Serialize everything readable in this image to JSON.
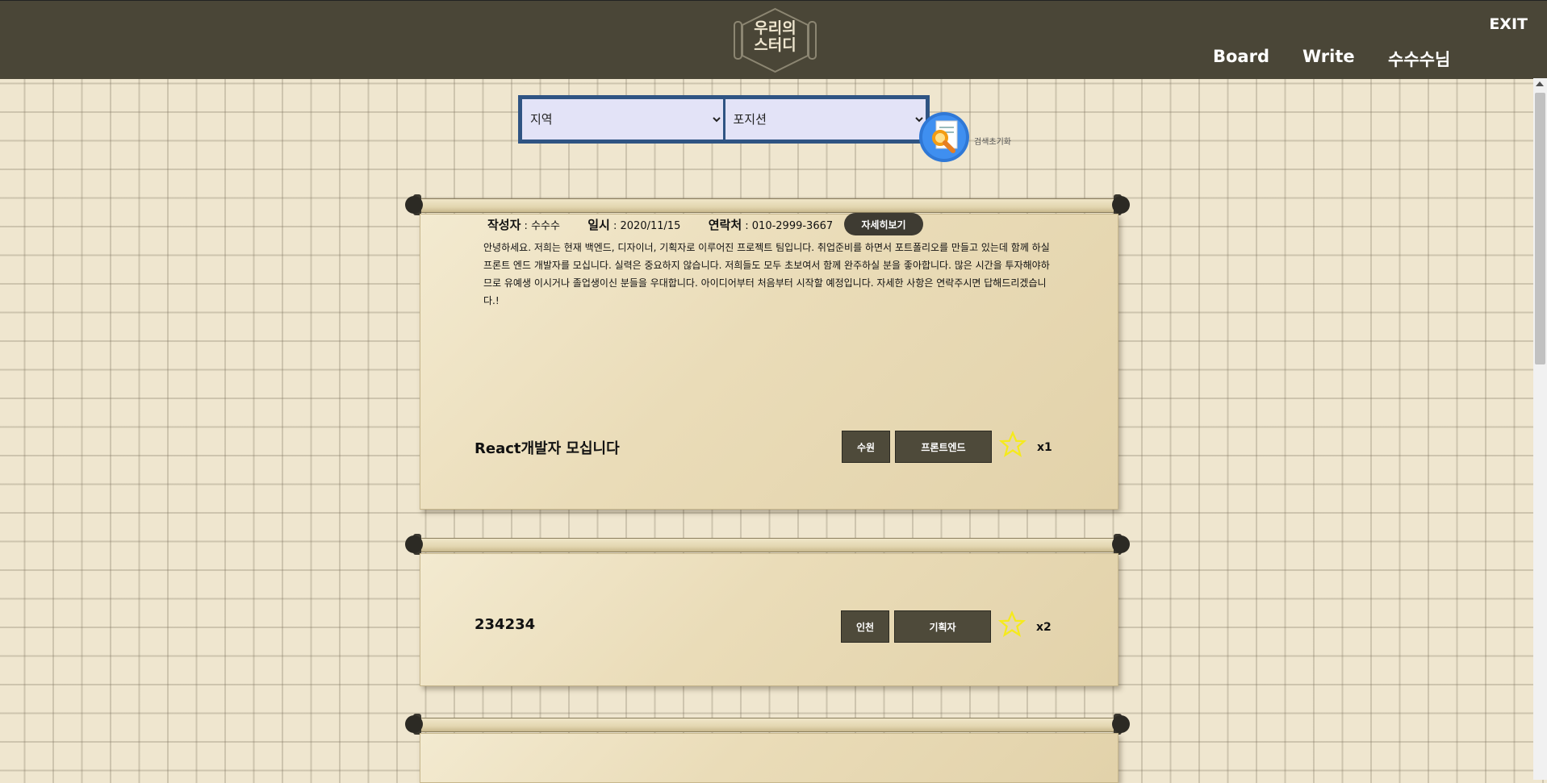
{
  "header": {
    "logo_text": "우리의\n스터디",
    "exit_label": "EXIT",
    "nav": {
      "board": "Board",
      "write": "Write",
      "user": "수수수님"
    }
  },
  "search": {
    "region_selected": "지역",
    "position_selected": "포지션",
    "reset_label": "검색초기화"
  },
  "posts": [
    {
      "meta": {
        "author_label": "작성자",
        "author": "수수수",
        "date_label": "일시",
        "date": "2020/11/15",
        "contact_label": "연락처",
        "contact": "010-2999-3667"
      },
      "detail_label": "자세히보기",
      "body": "안녕하세요. 저희는 현재 백엔드, 디자이너, 기획자로 이루어진 프로젝트 팀입니다. 취업준비를 하면서 포트폴리오를 만들고 있는데 함께 하실 프론트 엔드 개발자를 모십니다. 실력은 중요하지 않습니다. 저희들도 모두 초보여서 함께 완주하실 분을 좋아합니다. 많은 시간을 투자해야하므로 유예생 이시거나 졸업생이신 분들을 우대합니다. 아이디어부터 처음부터 시작할 예정입니다. 자세한 사항은 연락주시면 답해드리겠습니다.!",
      "title": "React개발자 모십니다",
      "region": "수원",
      "position": "프론트엔드",
      "count": "x1"
    },
    {
      "title": "234234",
      "region": "인천",
      "position": "기획자",
      "count": "x2"
    }
  ],
  "colors": {
    "header_bg": "#4a4637",
    "search_border": "#2f5483",
    "star": "#f5ea1c",
    "tag_bg": "#4e4a3a"
  },
  "icons": [
    "logo-emblem",
    "search-document-icon",
    "star-icon",
    "scroll-rod"
  ]
}
